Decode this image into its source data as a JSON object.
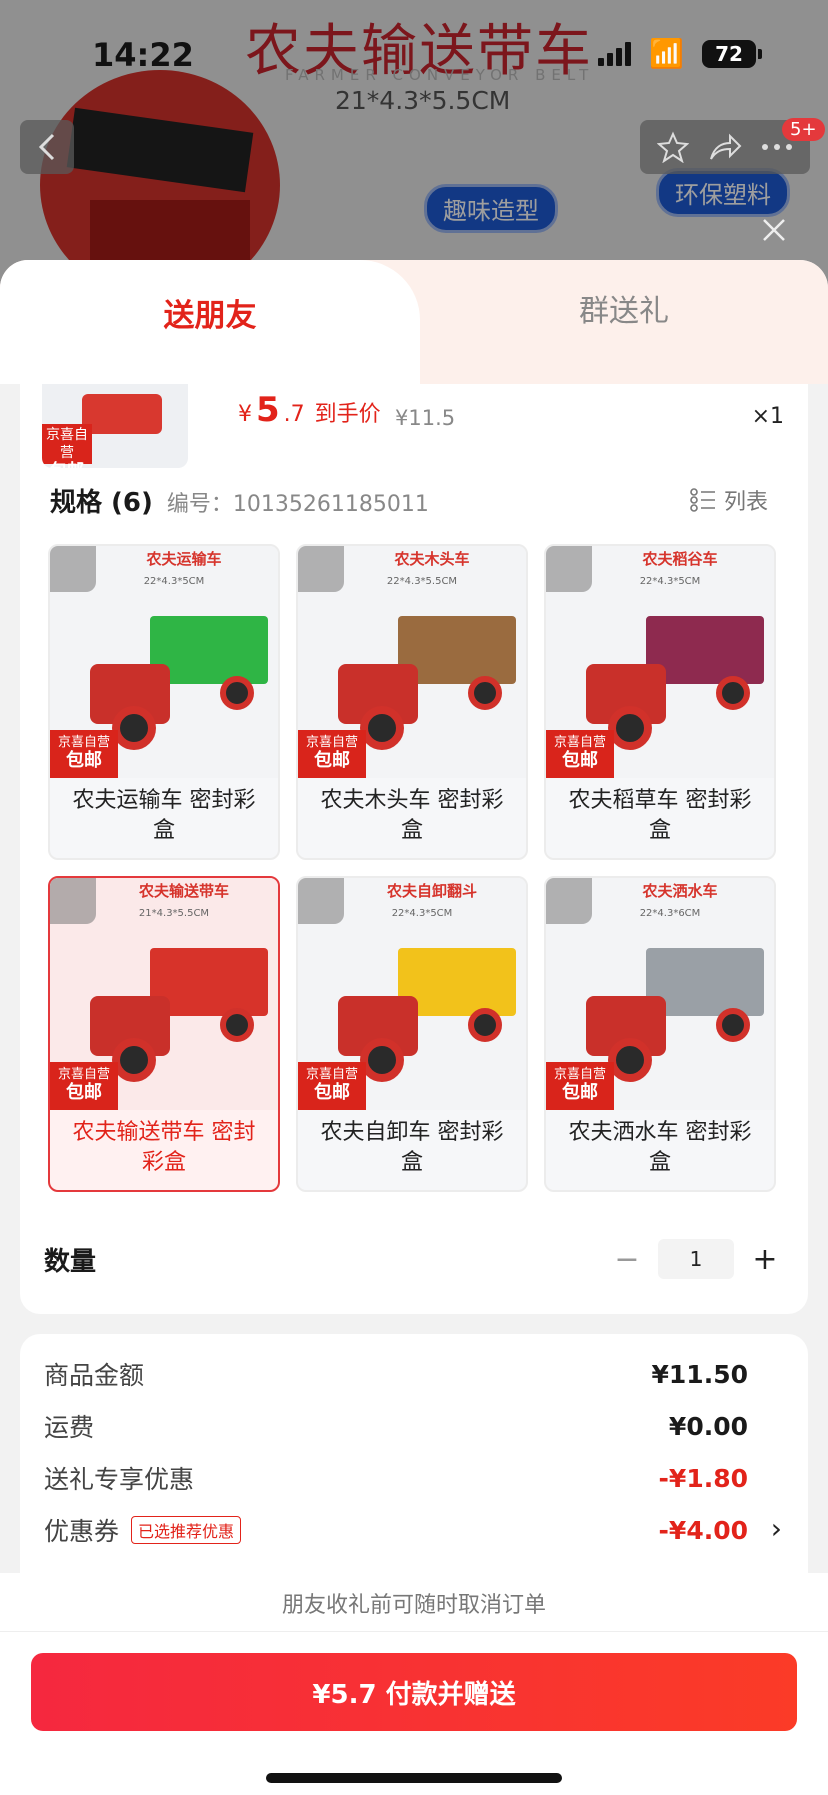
{
  "status_bar": {
    "time": "14:22",
    "battery": "72"
  },
  "backdrop": {
    "title": "农夫输送带车",
    "subtitle": "FARMER CONVEYOR BELT",
    "dimensions": "21*4.3*5.5CM",
    "callouts": [
      "趣味造型",
      "环保塑料"
    ],
    "cart_badge": "5+"
  },
  "tabs": {
    "active": "送朋友",
    "other": "群送礼"
  },
  "product": {
    "badge_line1": "京喜自营",
    "badge_line2": "包邮",
    "price_currency": "¥",
    "price_int": "5",
    "price_dec": ".7",
    "price_label": "到手价",
    "original_price": "¥11.5",
    "quantity_mark": "×1"
  },
  "spec": {
    "title": "规格 (6)",
    "code": "编号：10135261185011",
    "view_toggle": "列表",
    "options": [
      {
        "img_title": "农夫运输车",
        "img_dims": "22*4.3*5CM",
        "label": "农夫运输车 密封彩盒",
        "color": "#2fb545",
        "selected": false
      },
      {
        "img_title": "农夫木头车",
        "img_dims": "22*4.3*5.5CM",
        "label": "农夫木头车 密封彩盒",
        "color": "#9a6b3f",
        "selected": false
      },
      {
        "img_title": "农夫稻谷车",
        "img_dims": "22*4.3*5CM",
        "label": "农夫稻草车 密封彩盒",
        "color": "#8e2a4f",
        "selected": false
      },
      {
        "img_title": "农夫输送带车",
        "img_dims": "21*4.3*5.5CM",
        "label": "农夫输送带车 密封彩盒",
        "color": "#d7332a",
        "selected": true
      },
      {
        "img_title": "农夫自卸翻斗",
        "img_dims": "22*4.3*5CM",
        "label": "农夫自卸车 密封彩盒",
        "color": "#f2c21b",
        "selected": false
      },
      {
        "img_title": "农夫洒水车",
        "img_dims": "22*4.3*6CM",
        "label": "农夫洒水车 密封彩盒",
        "color": "#9aa0a6",
        "selected": false
      }
    ],
    "badge_line1": "京喜自营",
    "badge_line2": "包邮"
  },
  "quantity": {
    "label": "数量",
    "value": "1",
    "minus": "−",
    "plus": "+"
  },
  "summary": {
    "rows": [
      {
        "label": "商品金额",
        "value": "¥11.50"
      },
      {
        "label": "运费",
        "value": "¥0.00"
      },
      {
        "label": "送礼专享优惠",
        "value": "-¥1.80"
      },
      {
        "label": "优惠券",
        "chip": "已选推荐优惠",
        "value": "-¥4.00"
      }
    ]
  },
  "footer": {
    "notice": "朋友收礼前可随时取消订单",
    "pay_button": "¥5.7 付款并赠送"
  },
  "colors": {
    "accent": "#e2231a",
    "tab_bg": "#fdf0eb",
    "button_start": "#f5283f",
    "button_end": "#fb3b27"
  }
}
